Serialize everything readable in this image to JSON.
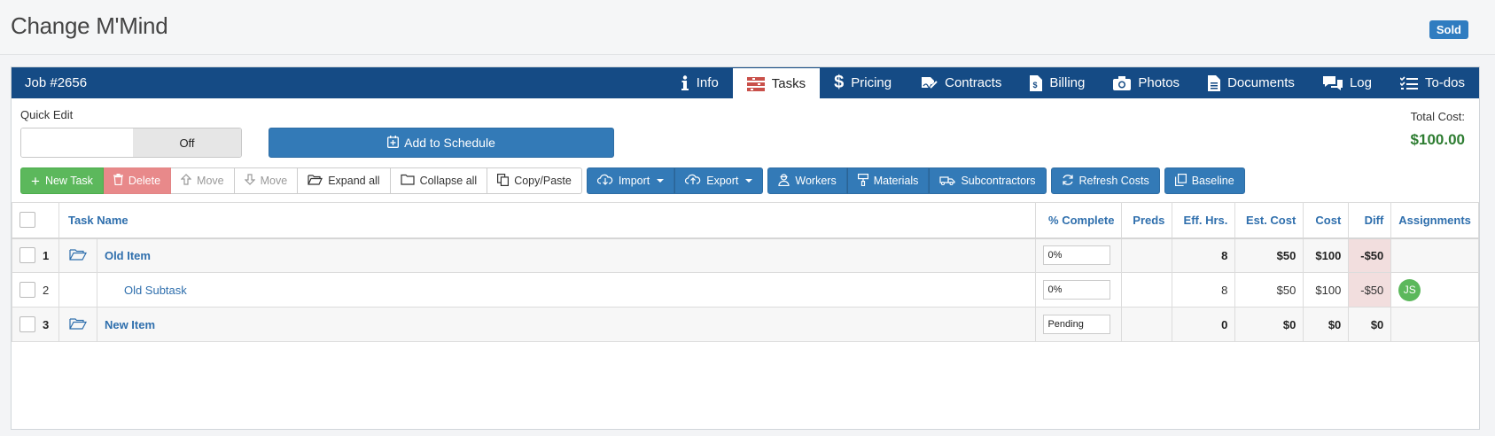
{
  "app": {
    "title": "Change M'Mind",
    "status_badge": "Sold"
  },
  "header": {
    "job_label": "Job #2656",
    "tabs": [
      {
        "label": "Info",
        "icon": "info-icon",
        "active": false
      },
      {
        "label": "Tasks",
        "icon": "tasks-icon",
        "active": true
      },
      {
        "label": "Pricing",
        "icon": "dollar-icon",
        "active": false
      },
      {
        "label": "Contracts",
        "icon": "signature-icon",
        "active": false
      },
      {
        "label": "Billing",
        "icon": "invoice-icon",
        "active": false
      },
      {
        "label": "Photos",
        "icon": "camera-icon",
        "active": false
      },
      {
        "label": "Documents",
        "icon": "document-icon",
        "active": false
      },
      {
        "label": "Log",
        "icon": "chat-icon",
        "active": false
      },
      {
        "label": "To-dos",
        "icon": "checklist-icon",
        "active": false
      }
    ]
  },
  "quick_edit": {
    "label": "Quick Edit",
    "state": "Off"
  },
  "schedule": {
    "button_label": "Add to Schedule"
  },
  "totals": {
    "label": "Total Cost:",
    "value": "$100.00"
  },
  "toolbar": {
    "new_task": "New Task",
    "delete": "Delete",
    "move_up": "Move",
    "move_down": "Move",
    "expand_all": "Expand all",
    "collapse_all": "Collapse all",
    "copy_paste": "Copy/Paste",
    "import": "Import",
    "export": "Export",
    "workers": "Workers",
    "materials": "Materials",
    "subcontractors": "Subcontractors",
    "refresh_costs": "Refresh Costs",
    "baseline": "Baseline"
  },
  "table": {
    "columns": {
      "task_name": "Task Name",
      "pct_complete": "% Complete",
      "preds": "Preds",
      "eff_hrs": "Eff. Hrs.",
      "est_cost": "Est. Cost",
      "cost": "Cost",
      "diff": "Diff",
      "assignments": "Assignments"
    },
    "rows": [
      {
        "num": "1",
        "name": "Old Item",
        "pct": "0%",
        "preds": "",
        "eff_hrs": "8",
        "est_cost": "$50",
        "cost": "$100",
        "diff": "-$50",
        "assignee": ""
      },
      {
        "num": "2",
        "name": "Old Subtask",
        "pct": "0%",
        "preds": "",
        "eff_hrs": "8",
        "est_cost": "$50",
        "cost": "$100",
        "diff": "-$50",
        "assignee": "JS"
      },
      {
        "num": "3",
        "name": "New Item",
        "pct": "Pending",
        "preds": "",
        "eff_hrs": "0",
        "est_cost": "$0",
        "cost": "$0",
        "diff": "$0",
        "assignee": ""
      }
    ]
  },
  "colors": {
    "header_bg": "#154b85",
    "primary_blue": "#337ab7",
    "success_green": "#5cb85c",
    "danger_red": "#e8898a",
    "total_green": "#2e7d32",
    "diff_negative_bg": "#f2dede"
  }
}
